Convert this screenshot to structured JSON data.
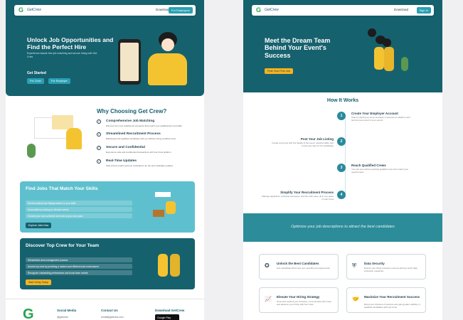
{
  "colors": {
    "primary": "#16616e",
    "accent": "#2aa0b3",
    "yellow": "#f4b321",
    "brand_green": "#26a34f"
  },
  "left": {
    "nav": {
      "logo": "G",
      "brand": "GetCrew",
      "download": "Download",
      "cta": "For Employers"
    },
    "hero": {
      "title": "Unlock Job Opportunities and Find the Perfect Hire",
      "subtitle": "Experience hassle-free job matching and secure hiring with Get Crew",
      "get_started": "Get Started",
      "btn_crew": "For Crew",
      "btn_employer": "For Employer"
    },
    "why": {
      "title": "Why Choosing Get Crew?",
      "features": [
        {
          "title": "Comprehensive Job Matching",
          "desc": "Discover the most suitable job prospects that match your qualifications and skills",
          "icon": "check-circle-icon"
        },
        {
          "title": "Streamlined Recruitment Process",
          "desc": "Effortlessly find qualified candidates with our efficient hiring workflow tools",
          "icon": "check-circle-icon"
        },
        {
          "title": "Secure and Confidential",
          "desc": "Experience safe and confidential transactions with Get Crew platform",
          "icon": "check-circle-icon"
        },
        {
          "title": "Real-Time Updates",
          "desc": "Stay informed with real-time notifications for job and candidate updates",
          "icon": "check-circle-icon"
        }
      ]
    },
    "find_jobs": {
      "title": "Find Jobs That Match Your Skills",
      "items": [
        "Receive tailored job listings based on your skills",
        "Grow skills by working on diverse events",
        "Choose your own schedule and work at your own pace"
      ],
      "button": "Explore Jobs Now"
    },
    "discover": {
      "title": "Discover Top Crew for Your Team",
      "items": [
        "Streamlined crew management process",
        "Access top crew by providing a modern and efficient work environment",
        "Recognize outstanding performance and boost team morale"
      ],
      "button": "Start Hiring Today"
    },
    "footer": {
      "logo": "G",
      "social_title": "Social Media",
      "social_value": "@getcrew",
      "contact_title": "Contact Us",
      "contact_value": "email@getcrew.com",
      "download_title": "Download GetCrew",
      "store": "Google Play"
    }
  },
  "right": {
    "nav": {
      "logo": "G",
      "brand": "GetCrew",
      "download": "Download",
      "cta": "Sign In"
    },
    "hero": {
      "title": "Meet the Dream Team Behind Your Event's Success",
      "button": "Post Your First Job"
    },
    "how": {
      "title": "How It Works",
      "steps": [
        {
          "n": "1",
          "title": "Create Your Employer Account",
          "desc": "Start by signing up as an employer to access our platform and find the best crew for your events"
        },
        {
          "n": "2",
          "title": "Post Your Job Listing",
          "desc": "Create a job post with the details of the event, required skills, and hourly pay rate for the candidates"
        },
        {
          "n": "3",
          "title": "Reach Qualified Crews",
          "desc": "Your job post will be reaching qualified crew who match your requirements"
        },
        {
          "n": "4",
          "title": "Simplify Your Recruitment Process",
          "desc": "Manage applicants, schedule interviews, and hire with ease, all in one place on Get Crew"
        }
      ]
    },
    "band": "Optimize your job descriptions to attract the best candidates",
    "benefits": [
      {
        "icon": "award-icon",
        "title": "Unlock the Best Candidates",
        "desc": "Hire candidates that meet your specific job requirements"
      },
      {
        "icon": "shield-icon",
        "title": "Data Security",
        "desc": "Ensure your hiring process is secure with top-notch data protection measures"
      },
      {
        "icon": "chart-icon",
        "title": "Elevate Your Hiring Strategy",
        "desc": "Grow and expand your business, communicate with Crew, and advance your hiring with Get Crew"
      },
      {
        "icon": "handshake-icon",
        "title": "Maximize Your Recruitment Success",
        "desc": "Boost your chances of success and gain greater visibility of qualified candidates with Get Crew"
      }
    ]
  }
}
